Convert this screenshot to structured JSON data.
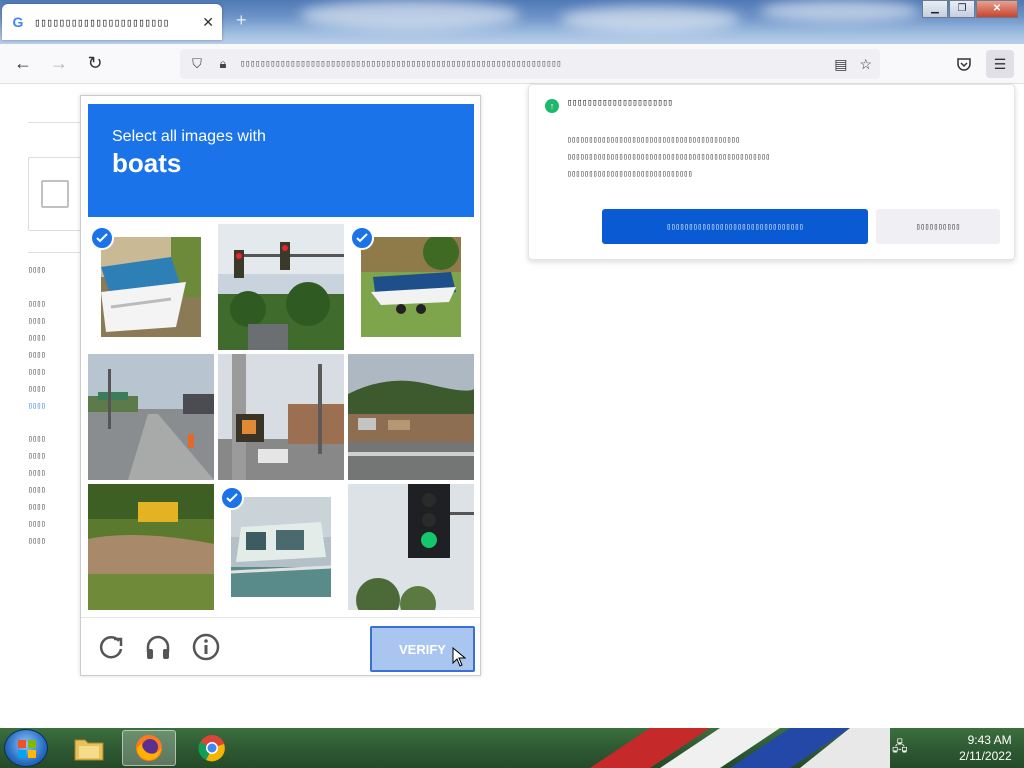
{
  "browser": {
    "tab_title": "▯▯▯▯▯▯▯▯▯▯▯▯▯▯▯▯▯▯▯▯▯▯",
    "tab_favicon": "G",
    "url_text": "▯▯▯▯▯▯▯▯▯▯▯▯▯▯▯▯▯▯▯▯▯▯▯▯▯▯▯▯▯▯▯▯▯▯▯▯▯▯▯▯▯▯▯▯▯▯▯▯▯▯▯▯▯▯▯▯▯▯▯▯▯▯▯▯"
  },
  "page": {
    "side_text_1": [
      "▯▯▯▯"
    ],
    "side_text_2": [
      "▯▯▯▯",
      "▯▯▯▯",
      "▯▯▯▯",
      "▯▯▯▯",
      "▯▯▯▯",
      "▯▯▯▯",
      "▯▯▯▯"
    ],
    "side_text_3": [
      "▯▯▯▯",
      "▯▯▯▯",
      "▯▯▯▯",
      "▯▯▯▯",
      "▯▯▯▯",
      "▯▯▯▯",
      "▯▯▯▯"
    ]
  },
  "captcha": {
    "instruction_sub": "Select all images with",
    "instruction_main": "boats",
    "verify_label": "VERIFY",
    "tiles": [
      {
        "subject": "boat-covered",
        "selected": true
      },
      {
        "subject": "traffic-light",
        "selected": false
      },
      {
        "subject": "boat-trailer",
        "selected": true
      },
      {
        "subject": "street",
        "selected": false
      },
      {
        "subject": "crosswalk-signal",
        "selected": false
      },
      {
        "subject": "town-street",
        "selected": false
      },
      {
        "subject": "field-bus",
        "selected": false
      },
      {
        "subject": "boat-deck",
        "selected": true
      },
      {
        "subject": "green-traffic-light",
        "selected": false
      }
    ],
    "accent_color": "#1a73e8"
  },
  "notification": {
    "title": "▯▯▯▯▯▯▯▯▯▯▯▯▯▯▯▯▯▯▯▯▯",
    "body_lines": [
      "▯▯▯▯▯▯▯▯▯▯▯▯▯▯▯▯▯▯▯▯▯▯▯▯▯▯▯▯▯▯▯▯▯▯▯▯▯▯▯▯",
      "▯▯▯▯▯▯▯▯▯▯▯▯▯▯▯▯▯▯▯▯▯▯▯▯▯▯▯▯▯▯▯▯▯▯▯▯▯▯▯▯▯▯▯▯▯▯▯",
      "▯▯▯▯▯▯▯▯▯▯▯▯▯▯▯▯▯▯▯▯▯▯▯▯▯▯▯▯▯"
    ],
    "primary_label": "▯▯▯▯▯▯▯▯▯▯▯▯▯▯▯▯▯▯▯▯▯▯▯▯▯▯▯▯▯▯▯",
    "secondary_label": "▯▯▯▯▯▯▯▯▯▯"
  },
  "taskbar": {
    "time": "9:43 AM",
    "date": "2/11/2022"
  }
}
